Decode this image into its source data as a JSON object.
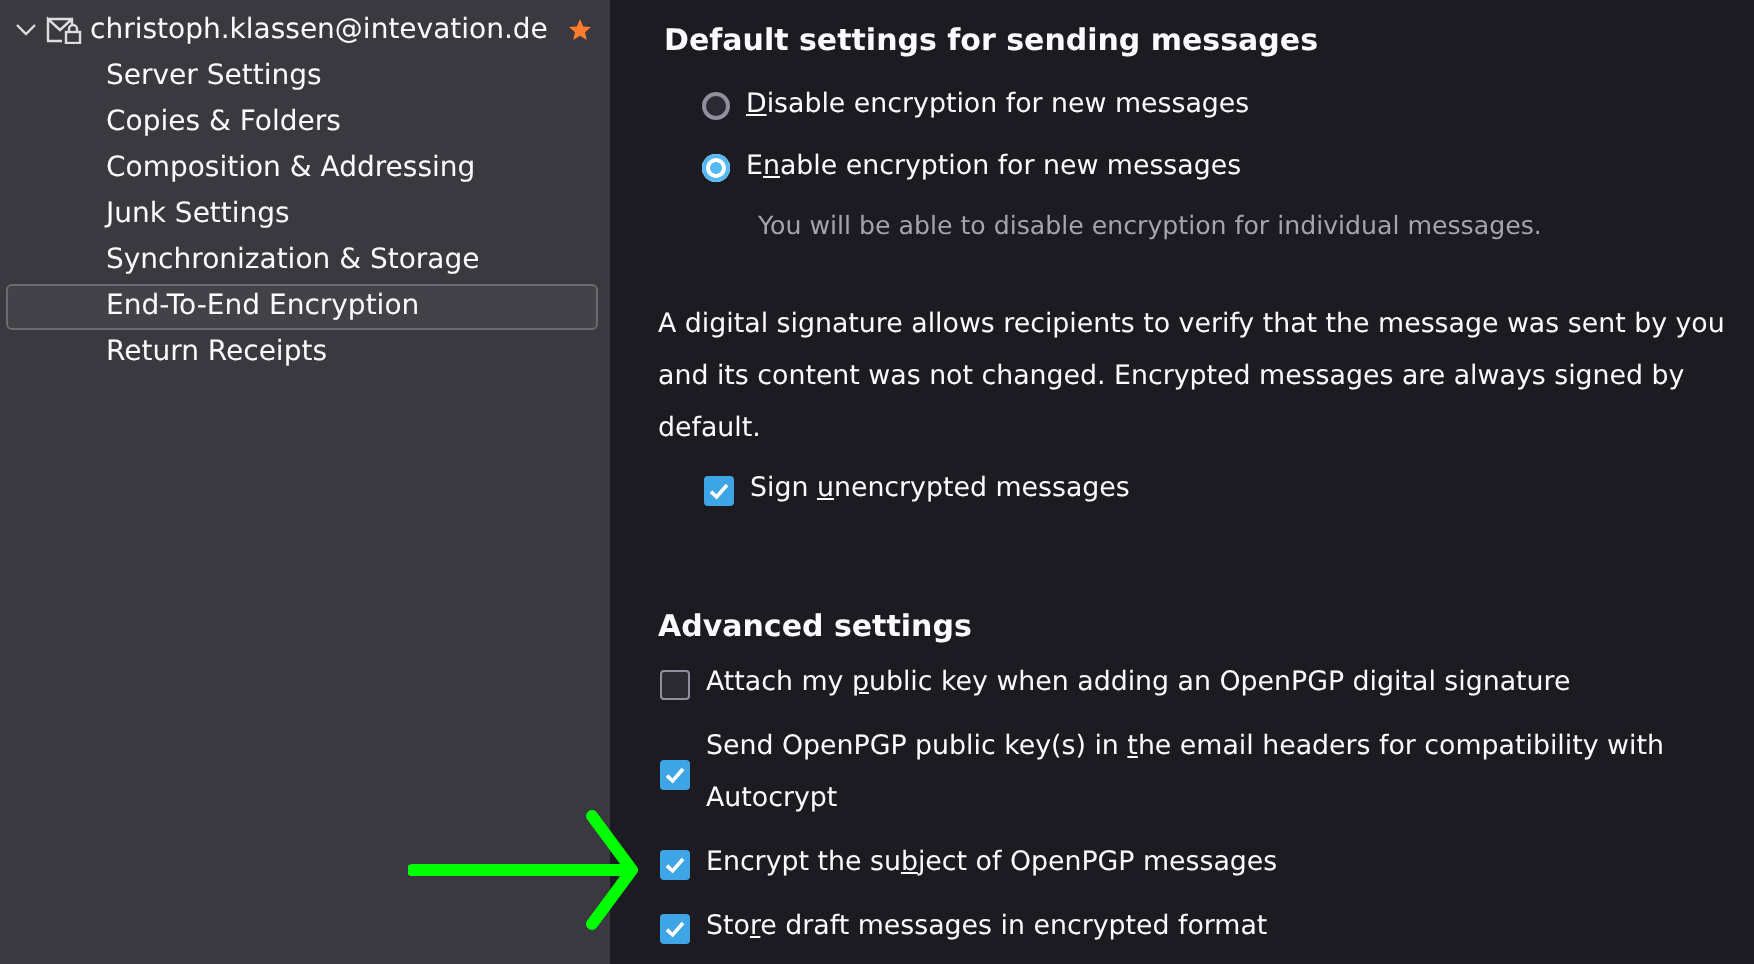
{
  "sidebar": {
    "account": {
      "label": "christoph.klassen@intevation.de",
      "expanded": true,
      "default": true
    },
    "items": [
      {
        "label": "Server Settings",
        "selected": false
      },
      {
        "label": "Copies & Folders",
        "selected": false
      },
      {
        "label": "Composition & Addressing",
        "selected": false
      },
      {
        "label": "Junk Settings",
        "selected": false
      },
      {
        "label": "Synchronization & Storage",
        "selected": false
      },
      {
        "label": "End-To-End Encryption",
        "selected": true
      },
      {
        "label": "Return Receipts",
        "selected": false
      }
    ]
  },
  "sending": {
    "heading": "Default settings for sending messages",
    "options": [
      {
        "key": "D",
        "after": "isable encryption for new messages",
        "selected": false
      },
      {
        "before": "E",
        "key": "n",
        "after": "able encryption for new messages",
        "selected": true
      }
    ],
    "hint": "You will be able to disable encryption for individual messages."
  },
  "signature": {
    "description": "A digital signature allows recipients to verify that the message was sent by you and its content was not changed. Encrypted messages are always signed by default.",
    "checkbox": {
      "before": "Sign ",
      "key": "u",
      "after": "nencrypted messages",
      "checked": true
    }
  },
  "advanced": {
    "heading": "Advanced settings",
    "options": [
      {
        "before": "Attach my ",
        "key": "p",
        "after": "ublic key when adding an OpenPGP digital signature",
        "checked": false
      },
      {
        "before": "Send OpenPGP public key(s) in ",
        "key": "t",
        "after": "he email headers for compatibility with Autocrypt",
        "checked": true
      },
      {
        "before": "Encrypt the su",
        "key": "b",
        "after": "ject of OpenPGP messages",
        "checked": true
      },
      {
        "before": "Sto",
        "key": "r",
        "after": "e draft messages in encrypted format",
        "checked": true
      }
    ]
  }
}
